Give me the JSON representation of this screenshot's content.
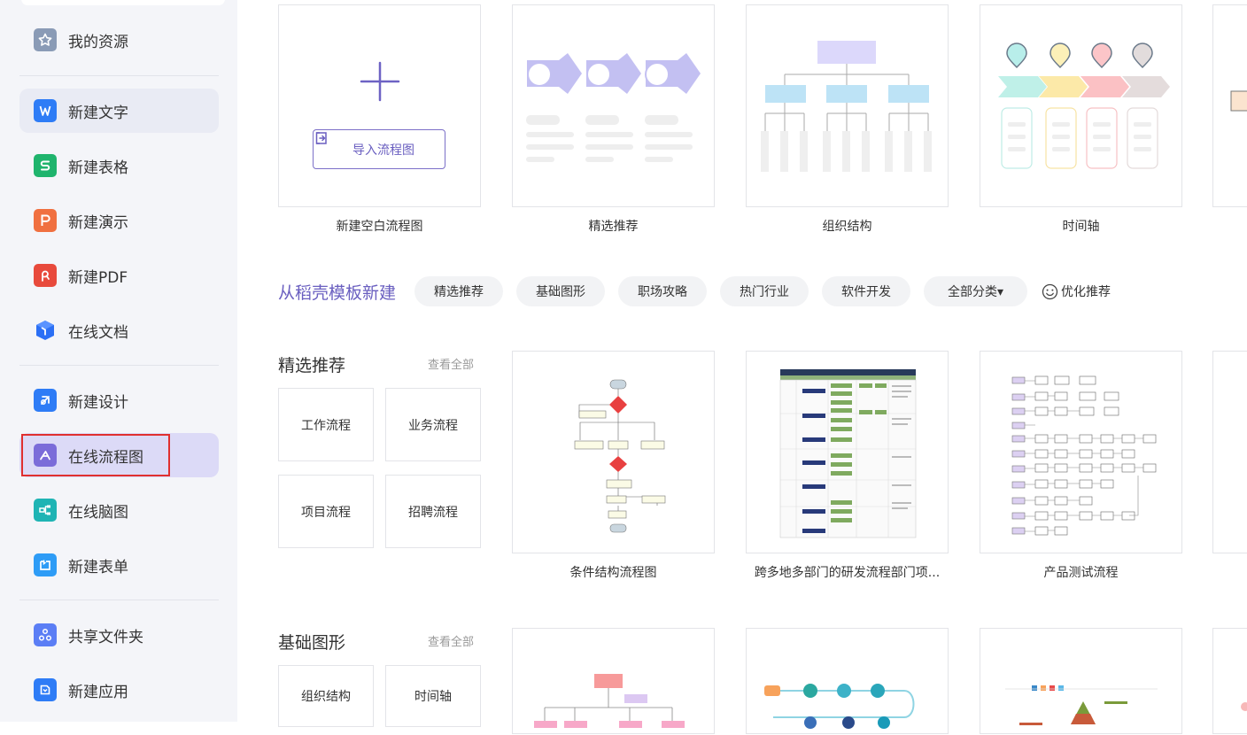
{
  "sidebar": {
    "items": [
      {
        "label": "我的资源",
        "icon": "star-icon",
        "color": "#8a9bb6"
      },
      {
        "label": "新建文字",
        "icon": "writer-icon",
        "color": "#2e7cf6"
      },
      {
        "label": "新建表格",
        "icon": "spreadsheet-icon",
        "color": "#1fb46d"
      },
      {
        "label": "新建演示",
        "icon": "presentation-icon",
        "color": "#f07040"
      },
      {
        "label": "新建PDF",
        "icon": "pdf-icon",
        "color": "#e84a3c"
      },
      {
        "label": "在线文档",
        "icon": "online-doc-icon",
        "color": "#2b6ff5"
      },
      {
        "label": "新建设计",
        "icon": "design-icon",
        "color": "#2e7cf6"
      },
      {
        "label": "在线流程图",
        "icon": "flowchart-icon",
        "color": "#7b6cd9"
      },
      {
        "label": "在线脑图",
        "icon": "mindmap-icon",
        "color": "#1fb4b4"
      },
      {
        "label": "新建表单",
        "icon": "form-icon",
        "color": "#2e9cf6"
      },
      {
        "label": "共享文件夹",
        "icon": "share-folder-icon",
        "color": "#5b7ef5"
      },
      {
        "label": "新建应用",
        "icon": "app-icon",
        "color": "#2e7cf6"
      }
    ]
  },
  "top_cards": {
    "blank": {
      "caption": "新建空白流程图",
      "import_label": "导入流程图"
    },
    "featured": {
      "caption": "精选推荐"
    },
    "org": {
      "caption": "组织结构"
    },
    "timeline": {
      "caption": "时间轴"
    }
  },
  "templates": {
    "title": "从稻壳模板新建",
    "chips": [
      "精选推荐",
      "基础图形",
      "职场攻略",
      "热门行业",
      "软件开发",
      "全部分类▾"
    ],
    "optimize_label": "优化推荐"
  },
  "section_featured": {
    "title": "精选推荐",
    "view_all": "查看全部",
    "minis": [
      "工作流程",
      "业务流程",
      "项目流程",
      "招聘流程"
    ],
    "cards": [
      "条件结构流程图",
      "跨多地多部门的研发流程部门项...",
      "产品测试流程"
    ]
  },
  "section_basic": {
    "title": "基础图形",
    "view_all": "查看全部",
    "minis": [
      "组织结构",
      "时间轴"
    ]
  },
  "colors": {
    "accent": "#6a5fc0",
    "active_bg": "#dcdaf7",
    "highlight_border": "#e03030"
  }
}
